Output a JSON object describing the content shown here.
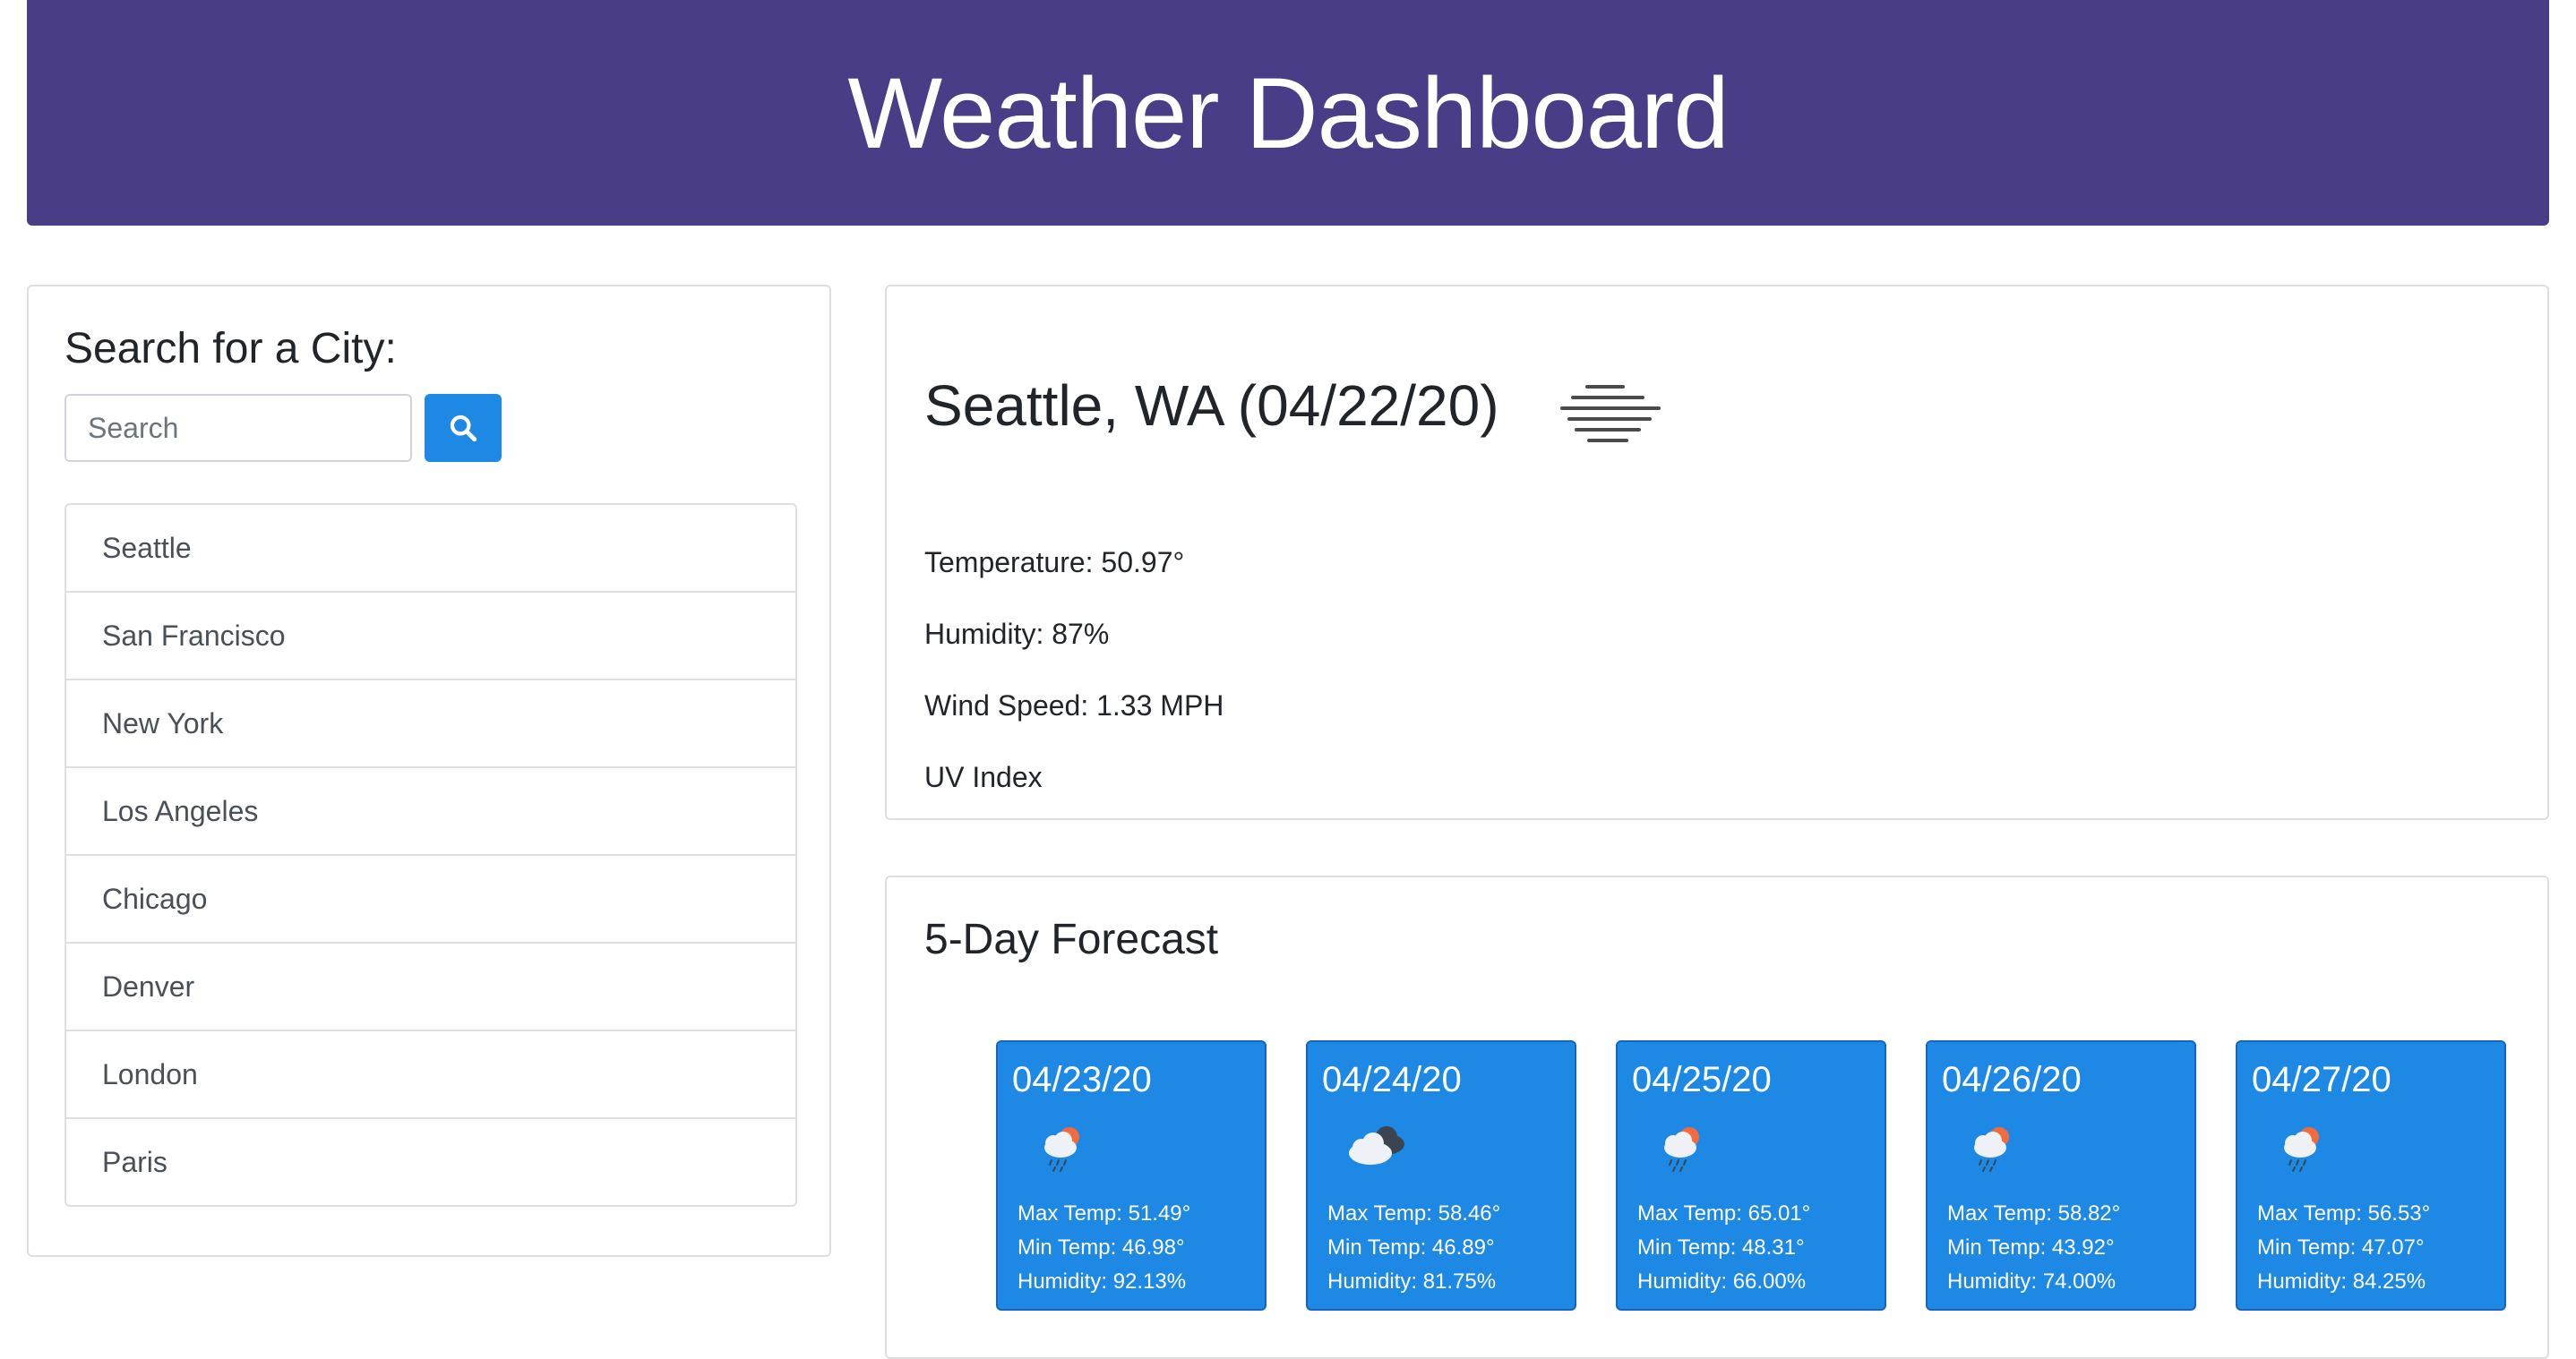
{
  "header": {
    "title": "Weather Dashboard"
  },
  "sidebar": {
    "heading": "Search for a City:",
    "search_placeholder": "Search",
    "search_value": "",
    "cities": [
      "Seattle",
      "San Francisco",
      "New York",
      "Los Angeles",
      "Chicago",
      "Denver",
      "London",
      "Paris"
    ]
  },
  "current": {
    "title": "Seattle, WA (04/22/20)",
    "icon": "mist-icon",
    "temperature": "Temperature: 50.97°",
    "humidity": "Humidity: 87%",
    "wind": "Wind Speed: 1.33 MPH",
    "uv": "UV Index"
  },
  "forecast": {
    "heading": "5-Day Forecast",
    "days": [
      {
        "date": "04/23/20",
        "icon": "rain-sun-icon",
        "max": "Max Temp: 51.49°",
        "min": "Min Temp: 46.98°",
        "humidity": "Humidity: 92.13%"
      },
      {
        "date": "04/24/20",
        "icon": "cloudy-icon",
        "max": "Max Temp: 58.46°",
        "min": "Min Temp: 46.89°",
        "humidity": "Humidity: 81.75%"
      },
      {
        "date": "04/25/20",
        "icon": "rain-sun-icon",
        "max": "Max Temp: 65.01°",
        "min": "Min Temp: 48.31°",
        "humidity": "Humidity: 66.00%"
      },
      {
        "date": "04/26/20",
        "icon": "rain-sun-icon",
        "max": "Max Temp: 58.82°",
        "min": "Min Temp: 43.92°",
        "humidity": "Humidity: 74.00%"
      },
      {
        "date": "04/27/20",
        "icon": "rain-sun-icon",
        "max": "Max Temp: 56.53°",
        "min": "Min Temp: 47.07°",
        "humidity": "Humidity: 84.25%"
      }
    ]
  },
  "colors": {
    "header_bg": "#493d87",
    "accent": "#1e88e5"
  }
}
